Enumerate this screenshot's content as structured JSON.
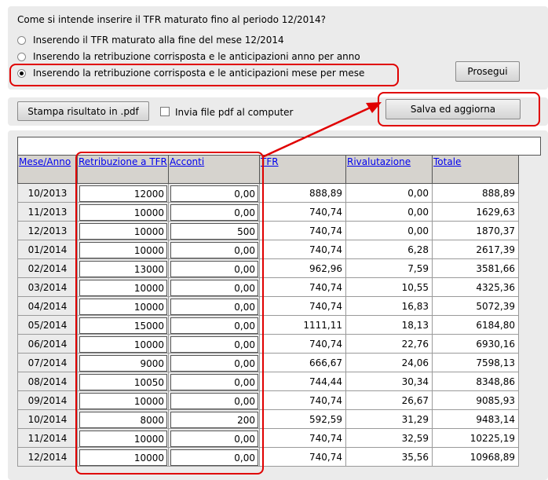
{
  "question": "Come si intende inserire il TFR maturato fino al periodo 12/2014?",
  "options": [
    {
      "label": "Inserendo il TFR maturato alla fine del mese 12/2014",
      "checked": false
    },
    {
      "label": "Inserendo la retribuzione corrisposta e le anticipazioni anno per anno",
      "checked": false
    },
    {
      "label": "Inserendo la retribuzione corrisposta e le anticipazioni mese per mese",
      "checked": true
    }
  ],
  "buttons": {
    "prosegui": "Prosegui",
    "stampa": "Stampa risultato in .pdf",
    "salva": "Salva ed aggiorna"
  },
  "checkbox_label": "Invia file pdf al computer",
  "table": {
    "headers": [
      "Mese/Anno",
      "Retribuzione a TFR",
      "Acconti",
      "TFR",
      "Rivalutazione",
      "Totale"
    ],
    "rows": [
      {
        "mese": "10/2013",
        "retribuzione": "12000",
        "acconti": "0,00",
        "tfr": "888,89",
        "rivalutazione": "0,00",
        "totale": "888,89"
      },
      {
        "mese": "11/2013",
        "retribuzione": "10000",
        "acconti": "0,00",
        "tfr": "740,74",
        "rivalutazione": "0,00",
        "totale": "1629,63"
      },
      {
        "mese": "12/2013",
        "retribuzione": "10000",
        "acconti": "500",
        "tfr": "740,74",
        "rivalutazione": "0,00",
        "totale": "1870,37"
      },
      {
        "mese": "01/2014",
        "retribuzione": "10000",
        "acconti": "0,00",
        "tfr": "740,74",
        "rivalutazione": "6,28",
        "totale": "2617,39"
      },
      {
        "mese": "02/2014",
        "retribuzione": "13000",
        "acconti": "0,00",
        "tfr": "962,96",
        "rivalutazione": "7,59",
        "totale": "3581,66"
      },
      {
        "mese": "03/2014",
        "retribuzione": "10000",
        "acconti": "0,00",
        "tfr": "740,74",
        "rivalutazione": "10,55",
        "totale": "4325,36"
      },
      {
        "mese": "04/2014",
        "retribuzione": "10000",
        "acconti": "0,00",
        "tfr": "740,74",
        "rivalutazione": "16,83",
        "totale": "5072,39"
      },
      {
        "mese": "05/2014",
        "retribuzione": "15000",
        "acconti": "0,00",
        "tfr": "1111,11",
        "rivalutazione": "18,13",
        "totale": "6184,80"
      },
      {
        "mese": "06/2014",
        "retribuzione": "10000",
        "acconti": "0,00",
        "tfr": "740,74",
        "rivalutazione": "22,76",
        "totale": "6930,16"
      },
      {
        "mese": "07/2014",
        "retribuzione": "9000",
        "acconti": "0,00",
        "tfr": "666,67",
        "rivalutazione": "24,06",
        "totale": "7598,13"
      },
      {
        "mese": "08/2014",
        "retribuzione": "10050",
        "acconti": "0,00",
        "tfr": "744,44",
        "rivalutazione": "30,34",
        "totale": "8348,86"
      },
      {
        "mese": "09/2014",
        "retribuzione": "10000",
        "acconti": "0,00",
        "tfr": "740,74",
        "rivalutazione": "26,67",
        "totale": "9085,93"
      },
      {
        "mese": "10/2014",
        "retribuzione": "8000",
        "acconti": "200",
        "tfr": "592,59",
        "rivalutazione": "31,29",
        "totale": "9483,14"
      },
      {
        "mese": "11/2014",
        "retribuzione": "10000",
        "acconti": "0,00",
        "tfr": "740,74",
        "rivalutazione": "32,59",
        "totale": "10225,19"
      },
      {
        "mese": "12/2014",
        "retribuzione": "10000",
        "acconti": "0,00",
        "tfr": "740,74",
        "rivalutazione": "35,56",
        "totale": "10968,89"
      }
    ]
  },
  "colors": {
    "annotation": "#e00000",
    "link": "#0000ee",
    "panel": "#ebebeb",
    "header": "#d6d3ce"
  }
}
